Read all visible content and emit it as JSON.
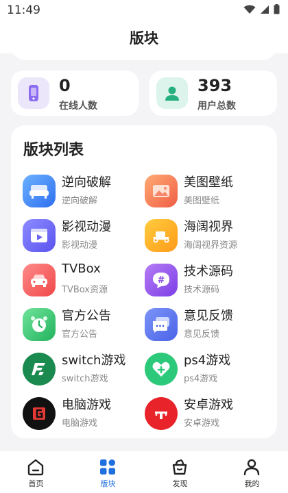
{
  "status_bar": {
    "time": "11:49"
  },
  "header": {
    "title": "版块"
  },
  "stats": {
    "online": {
      "value": "0",
      "label": "在线人数"
    },
    "users": {
      "value": "393",
      "label": "用户总数"
    }
  },
  "forum_section": {
    "title": "版块列表",
    "items": [
      {
        "name": "逆向破解",
        "sub": "逆向破解",
        "icon": "sofa-icon"
      },
      {
        "name": "美图壁纸",
        "sub": "美图壁纸",
        "icon": "image-icon"
      },
      {
        "name": "影视动漫",
        "sub": "影视动漫",
        "icon": "video-icon"
      },
      {
        "name": "海阔视界",
        "sub": "海阔视界资源",
        "icon": "scooter-icon"
      },
      {
        "name": "TVBox",
        "sub": "TVBox资源",
        "icon": "car-icon"
      },
      {
        "name": "技术源码",
        "sub": "技术源码",
        "icon": "hashtag-icon"
      },
      {
        "name": "官方公告",
        "sub": "官方公告",
        "icon": "alarm-clock-icon"
      },
      {
        "name": "意见反馈",
        "sub": "意见反馈",
        "icon": "chat-icon"
      },
      {
        "name": "switch游戏",
        "sub": "switch游戏",
        "icon": "switch-logo-icon"
      },
      {
        "name": "ps4游戏",
        "sub": "ps4游戏",
        "icon": "heart-icon"
      },
      {
        "name": "电脑游戏",
        "sub": "电脑游戏",
        "icon": "pc-game-logo-icon"
      },
      {
        "name": "安卓游戏",
        "sub": "安卓游戏",
        "icon": "android-game-logo-icon"
      }
    ]
  },
  "tabbar": {
    "tabs": [
      {
        "label": "首页",
        "icon": "home-icon"
      },
      {
        "label": "版块",
        "icon": "grid-icon",
        "active": true
      },
      {
        "label": "发现",
        "icon": "discover-basket-icon"
      },
      {
        "label": "我的",
        "icon": "user-icon"
      }
    ]
  },
  "colors": {
    "accent": "#1f6fde",
    "background": "#f4f4f6",
    "online_icon_bg": "#ece6fb",
    "users_icon_bg": "#dcf4ec"
  }
}
